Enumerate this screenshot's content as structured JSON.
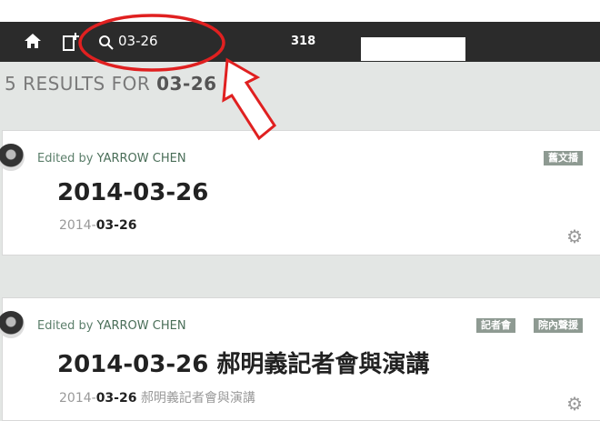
{
  "search": {
    "query": "03-26"
  },
  "navbar": {
    "count": "318"
  },
  "results": {
    "prefix": "5 RESULTS FOR ",
    "term": "03-26"
  },
  "posts": [
    {
      "editor_prefix": "Edited by ",
      "editor_name": "YARROW CHEN",
      "title": "2014-03-26",
      "sub_plain": "2014-",
      "sub_bold": "03-26",
      "sub_rest": "",
      "tags": [
        "舊文播"
      ]
    },
    {
      "editor_prefix": "Edited by ",
      "editor_name": "YARROW CHEN",
      "title": "2014-03-26 郝明義記者會與演講",
      "sub_plain": "2014-",
      "sub_bold": "03-26",
      "sub_rest": " 郝明義記者會與演講",
      "tags": [
        "記者會",
        "院內聲援"
      ]
    }
  ],
  "icons": [
    "home-icon",
    "new-post-icon",
    "search-icon",
    "gear-icon"
  ],
  "colors": {
    "navbar": "#2b2b2b",
    "annotation": "#e02020",
    "tag": "#8e9a92"
  }
}
